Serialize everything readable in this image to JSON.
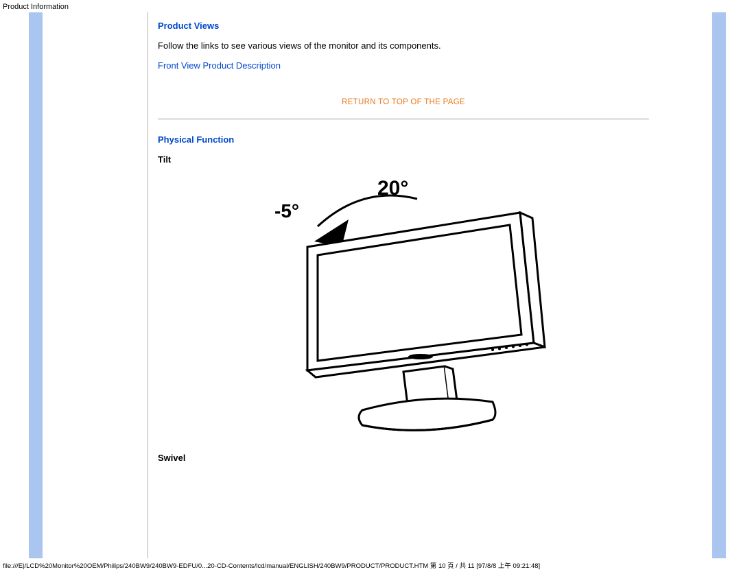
{
  "header": {
    "title": "Product Information"
  },
  "sections": {
    "views": {
      "heading": "Product Views",
      "intro": "Follow the links to see various views of the monitor and its components.",
      "front_link": "Front View Product Description"
    },
    "return_link": "RETURN TO TOP OF THE PAGE",
    "physical": {
      "heading": "Physical Function",
      "tilt_label": "Tilt",
      "tilt_angles": {
        "back": "-5°",
        "forward": "20°"
      },
      "swivel_label": "Swivel"
    }
  },
  "footer": {
    "path": "file:///E|/LCD%20Monitor%20OEM/Philips/240BW9/240BW9-EDFU/0...20-CD-Contents/lcd/manual/ENGLISH/240BW9/PRODUCT/PRODUCT.HTM 第 10 頁 / 共 11  [97/8/8 上午 09:21:48]"
  }
}
